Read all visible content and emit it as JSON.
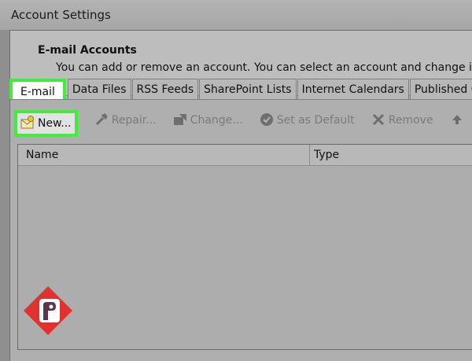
{
  "window": {
    "title": "Account Settings"
  },
  "header": {
    "title": "E-mail Accounts",
    "description": "You can add or remove an account. You can select an account and change its se"
  },
  "tabs": [
    {
      "label": "E-mail",
      "active": true
    },
    {
      "label": "Data Files"
    },
    {
      "label": "RSS Feeds"
    },
    {
      "label": "SharePoint Lists"
    },
    {
      "label": "Internet Calendars"
    },
    {
      "label": "Published C"
    }
  ],
  "toolbar": {
    "new_label": "New...",
    "repair_label": "Repair...",
    "change_label": "Change...",
    "set_default_label": "Set as Default",
    "remove_label": "Remove"
  },
  "list": {
    "columns": [
      "Name",
      "Type"
    ]
  },
  "colors": {
    "highlight": "#3cf037",
    "logo_red": "#e0332f"
  }
}
